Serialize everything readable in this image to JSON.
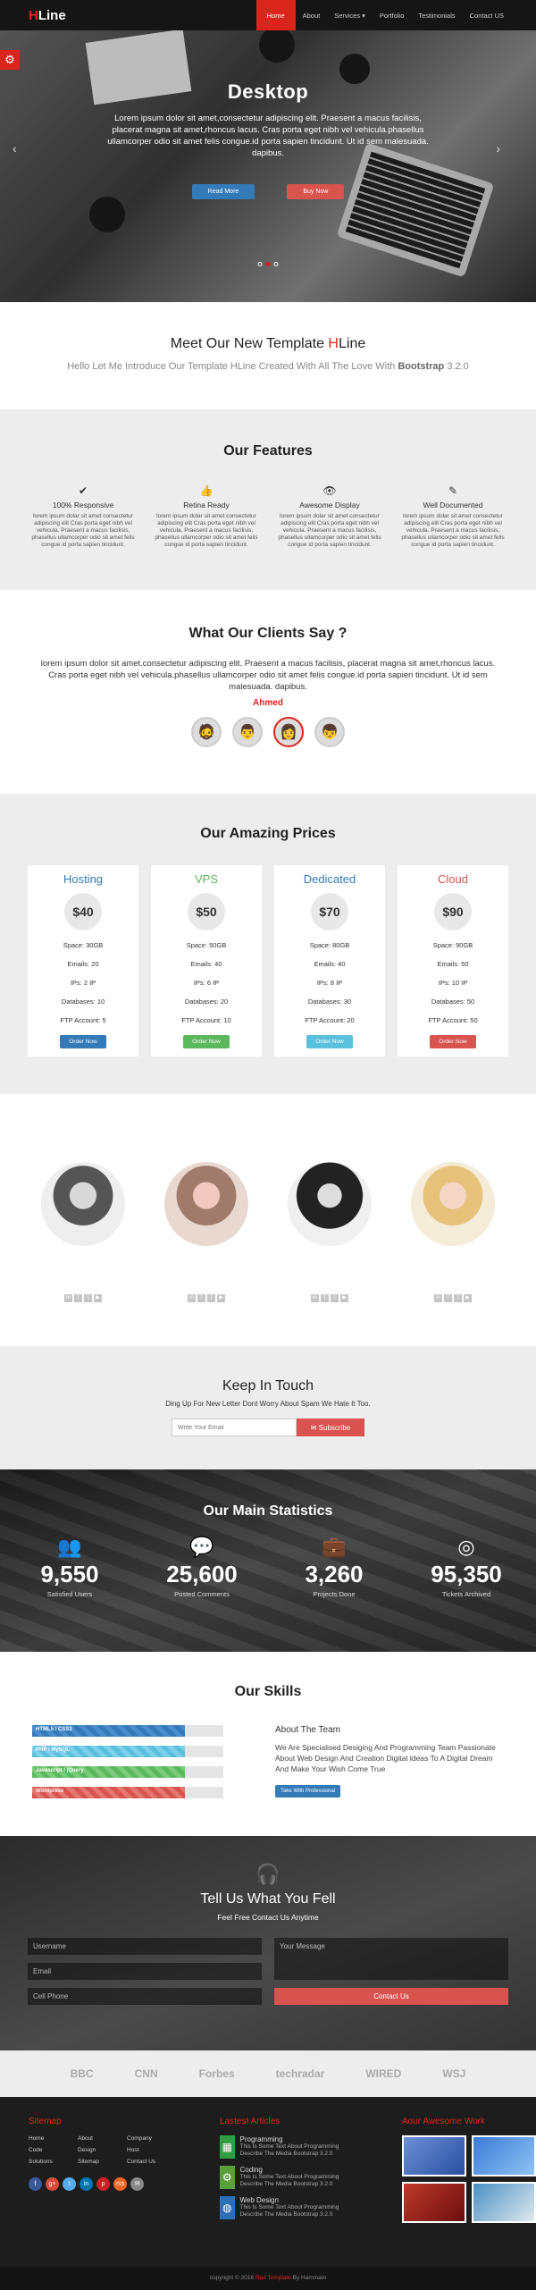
{
  "nav": {
    "brand_first": "H",
    "brand_rest": "Line",
    "items": [
      "Home",
      "About",
      "Services",
      "Portfolio",
      "Testimonials",
      "Contact US"
    ],
    "services_arrow": "▾"
  },
  "hero": {
    "title": "Desktop",
    "text": "Lorem ipsum dolor sit amet,consectetur adipiscing elit. Praesent a macus facilisis, placerat magna sit amet,rhoncus lacus. Cras porta eget nibh vel vehicula.phasellus ullamcorper odio sit amet felis congue.id porta sapien tincidunt. Ut id sem malesuada. dapibus.",
    "btn1": "Read More",
    "btn2": "Buy Now",
    "slides": 3,
    "active_slide": 2
  },
  "meet": {
    "title_pre": "Meet Our New Template ",
    "title_h": "H",
    "title_rest": "Line",
    "sub_pre": "Hello Let Me Introduce Our Template HLine Created With All The Love With ",
    "sub_bold": "Bootstrap",
    "sub_ver": " 3.2.0"
  },
  "features": {
    "title": "Our Features",
    "items": [
      {
        "icon": "check-icon",
        "glyph": "✔",
        "title": "100% Responsive",
        "text": "lorem ipsum dolar sit amet consectetur adipiscing elit Cras porta eget nibh vel vehicula. Praesent a macus facilisis, phasellus ullamcorper odio sit amet felis congue id porta sapien tincidunt."
      },
      {
        "icon": "thumbs-up-icon",
        "glyph": "👍",
        "title": "Retina Ready",
        "text": "lorem ipsum dolar sit amet consectetur adipiscing elit Cras porta eget nibh vel vehicula. Praesent a macus facilisis, phasellus ullamcorper odio sit amet felis congue id porta sapien tincidunt."
      },
      {
        "icon": "eye-icon",
        "glyph": "👁",
        "title": "Awesome Display",
        "text": "lorem ipsum dolar sit amet consectetur adipiscing elit Cras porta eget nibh vel vehicula. Praesent a macus facilisis, phasellus ullamcorper odio sit amet felis congue id porta sapien tincidunt."
      },
      {
        "icon": "pencil-icon",
        "glyph": "✎",
        "title": "Well Documented",
        "text": "lorem ipsum dolar sit amet consectetur adipiscing elit Cras porta eget nibh vel vehicula. Praesent a macus facilisis, phasellus ullamcorper odio sit amet felis congue id porta sapien tincidunt."
      }
    ]
  },
  "clients": {
    "title": "What Our Clients Say ?",
    "quote": "lorem ipsum dolor sit amet.consectetur adipiscing elit. Praesent a macus facilisis, placerat magna sit amet,rhoncus lacus. Cras porta eget nibh vel vehicula.phasellus ullamcorper odio sit amet felis congue.id porta sapien tincidunt. Ut id sem malesuada. dapibus.",
    "name": "Ahmed",
    "active_avatar": 2
  },
  "prices": {
    "title": "Our Amazing Prices",
    "plans": [
      {
        "name": "Hosting",
        "color": "#337ab7",
        "price": "$40",
        "space": "Space: 30GB",
        "emails": "Emails: 20",
        "ips": "IPs: 2 IP",
        "db": "Databases: 10",
        "ftp": "FTP Account: 5",
        "btn": "Order Now",
        "btn_class": "b-blue"
      },
      {
        "name": "VPS",
        "color": "#5cb85c",
        "price": "$50",
        "space": "Space: 50GB",
        "emails": "Emails: 40",
        "ips": "IPs: 6 IP",
        "db": "Databases: 20",
        "ftp": "FTP Account: 10",
        "btn": "Order Now",
        "btn_class": "b-green"
      },
      {
        "name": "Dedicated",
        "color": "#337ab7",
        "price": "$70",
        "space": "Space: 80GB",
        "emails": "Emails: 40",
        "ips": "IPs: 8 IP",
        "db": "Databases: 30",
        "ftp": "FTP Account: 20",
        "btn": "Order Now",
        "btn_class": "b-cyan"
      },
      {
        "name": "Cloud",
        "color": "#d9534f",
        "price": "$90",
        "space": "Space: 90GB",
        "emails": "Emails: 50",
        "ips": "IPs: 10 IP",
        "db": "Databases: 50",
        "ftp": "FTP Account: 50",
        "btn": "Order Now",
        "btn_class": "b-red"
      }
    ]
  },
  "team": {
    "social_icons": [
      "linkedin-icon",
      "facebook-icon",
      "twitter-icon",
      "youtube-icon"
    ],
    "social_glyphs": [
      "in",
      "f",
      "t",
      "▶"
    ]
  },
  "touch": {
    "title": "Keep In Touch",
    "text": "Ding Up For New Letter Dont Worry About Spam We Hate It Too.",
    "placeholder": "Write Your Email",
    "btn": "✉ Subscribe"
  },
  "stats": {
    "title": "Our Main Statistics",
    "items": [
      {
        "icon": "users-icon",
        "glyph": "👥",
        "num": "9,550",
        "label": "Satisfied Users"
      },
      {
        "icon": "comments-icon",
        "glyph": "💬",
        "num": "25,600",
        "label": "Posted Comments"
      },
      {
        "icon": "briefcase-icon",
        "glyph": "💼",
        "num": "3,260",
        "label": "Projects Done"
      },
      {
        "icon": "lifebuoy-icon",
        "glyph": "◎",
        "num": "95,350",
        "label": "Tickets Archived"
      }
    ]
  },
  "skills": {
    "title": "Our Skills",
    "bars": [
      {
        "label": "HTML5 / CSS3",
        "percent": 80,
        "color": "blue"
      },
      {
        "label": "PHP / MySQL",
        "percent": 80,
        "color": "cyan"
      },
      {
        "label": "Javascript / jQuery",
        "percent": 80,
        "color": "green"
      },
      {
        "label": "Wordpress",
        "percent": 80,
        "color": "red"
      }
    ],
    "about_title": "About The Team",
    "about_text": "We Are Specialised Desiging And Programming Team Passionate About Web Design And Creation Digital Ideas To A Digital Dream And Make Your Wish Come True",
    "about_btn": "Take With Professional"
  },
  "contact": {
    "title": "Tell Us What You Fell",
    "sub": "Feel Free Contact Us Anytime",
    "username": "Username",
    "email": "Email",
    "phone": "Cell Phone",
    "message": "Your Message",
    "btn": "Contact Us"
  },
  "logos": [
    "BBC",
    "CNN",
    "Forbes",
    "techradar",
    "WIRED",
    "WSJ"
  ],
  "footer": {
    "sitemap_title": "Sitemap",
    "links": [
      "Home",
      "About",
      "Company",
      "Code",
      "Design",
      "Host",
      "Solutions",
      "Sitemap",
      "Contact Us"
    ],
    "social": [
      {
        "glyph": "f",
        "color": "#3b5998"
      },
      {
        "glyph": "g+",
        "color": "#dd4b39"
      },
      {
        "glyph": "t",
        "color": "#55acee"
      },
      {
        "glyph": "in",
        "color": "#0077b5"
      },
      {
        "glyph": "p",
        "color": "#cb2027"
      },
      {
        "glyph": "rss",
        "color": "#f26522"
      },
      {
        "glyph": "✉",
        "color": "#888"
      }
    ],
    "articles_title": "Lastest Articles",
    "articles": [
      {
        "icon": "calculator-icon",
        "glyph": "▦",
        "color": "#2e9e45",
        "title": "Programming",
        "text": "This Is Some Text About Programming Describe The Media Bootstrap 3.2.0"
      },
      {
        "icon": "android-icon",
        "glyph": "⚙",
        "color": "#5aa03a",
        "title": "Coding",
        "text": "This Is Some Text About Programming Describe The Media Bootstrap 3.2.0"
      },
      {
        "icon": "globe-icon",
        "glyph": "◍",
        "color": "#2d6fb5",
        "title": "Web Design",
        "text": "This Is Some Text About Programming Describe The Media Bootstrap 3.2.0"
      }
    ],
    "work_title": "Aour Awesome Work"
  },
  "copy": {
    "pre": "copyright © 2016 ",
    "link": "Red Template",
    "mid": " By ",
    "author": "Hammam"
  }
}
